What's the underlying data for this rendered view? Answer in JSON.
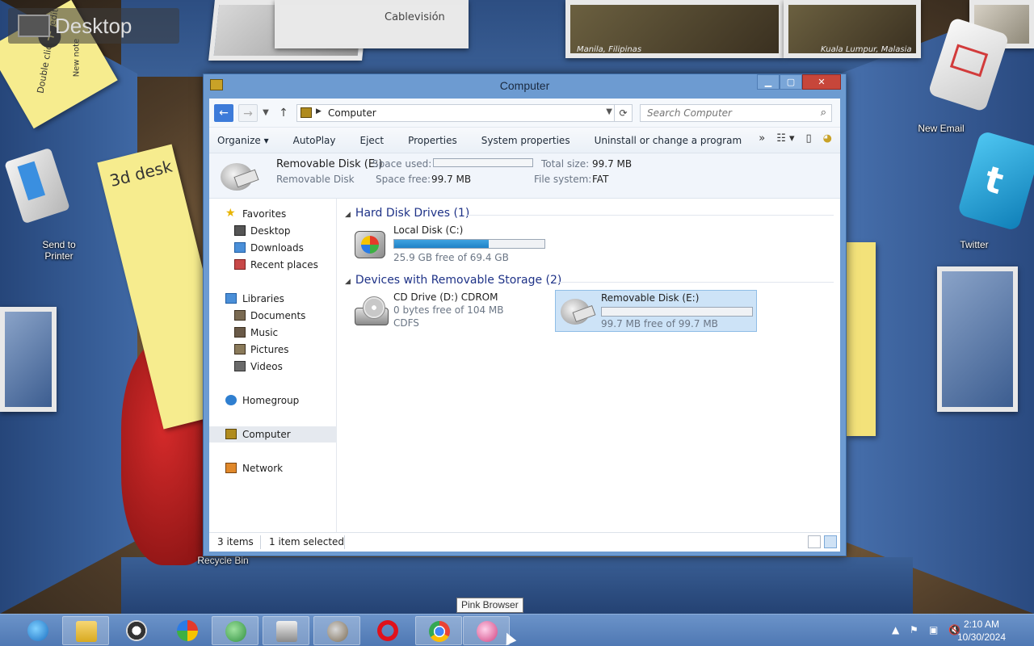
{
  "desktop": {
    "title": "Desktop",
    "icons": [
      {
        "label": "Send to Printer"
      },
      {
        "label": "New Email"
      },
      {
        "label": "Twitter"
      },
      {
        "label": "Recycle Bin"
      }
    ],
    "sticky_notes": [
      "Double click to edit",
      "New note",
      "3d desk"
    ],
    "photo_captions": [
      "Manila, Filipinas",
      "Kuala Lumpur, Malasia",
      "Cablevisión"
    ]
  },
  "window": {
    "title": "Computer",
    "address": "Computer",
    "search_placeholder": "Search Computer",
    "commands": [
      "Organize",
      "AutoPlay",
      "Eject",
      "Properties",
      "System properties",
      "Uninstall or change a program"
    ],
    "more_glyph": "»",
    "details": {
      "name": "Removable Disk (E:)",
      "type": "Removable Disk",
      "space_used_label": "Space used:",
      "space_used_fraction": 0.0,
      "space_free_label": "Space free:",
      "space_free": "99.7 MB",
      "total_size_label": "Total size:",
      "total_size": "99.7 MB",
      "file_system_label": "File system:",
      "file_system": "FAT"
    },
    "nav": {
      "favorites": "Favorites",
      "desktop": "Desktop",
      "downloads": "Downloads",
      "recent": "Recent places",
      "libraries": "Libraries",
      "documents": "Documents",
      "music": "Music",
      "pictures": "Pictures",
      "videos": "Videos",
      "homegroup": "Homegroup",
      "computer": "Computer",
      "network": "Network"
    },
    "groups": {
      "hdd": "Hard Disk Drives (1)",
      "removable": "Devices with Removable Storage (2)"
    },
    "drives": {
      "c": {
        "name": "Local Disk (C:)",
        "free": "25.9 GB free of 69.4 GB",
        "used_fraction": 0.627
      },
      "d": {
        "name": "CD Drive (D:) CDROM",
        "free": "0 bytes free of 104 MB",
        "fs": "CDFS"
      },
      "e": {
        "name": "Removable Disk (E:)",
        "free": "99.7 MB free of 99.7 MB",
        "used_fraction": 0.0
      }
    },
    "status": {
      "items": "3 items",
      "selected": "1 item selected"
    }
  },
  "taskbar": {
    "tooltip": "Pink Browser",
    "time": "2:10 AM",
    "date": "10/30/2024"
  },
  "colors": {
    "accent": "#3d7bd9",
    "window_frame": "#6d9bd1",
    "close": "#c7463a",
    "drive_fill": "#1f82c7"
  }
}
